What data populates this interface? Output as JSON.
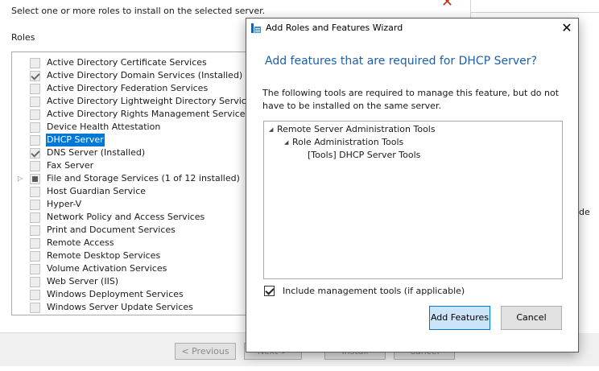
{
  "background": {
    "instruction": "Select one or more roles to install on the selected server.",
    "roles_heading": "Roles",
    "side_fragment": "de",
    "roles": [
      {
        "label": "Active Directory Certificate Services",
        "state": "unchecked",
        "expandable": false,
        "selected": false
      },
      {
        "label": "Active Directory Domain Services (Installed)",
        "state": "checked",
        "expandable": false,
        "selected": false
      },
      {
        "label": "Active Directory Federation Services",
        "state": "unchecked",
        "expandable": false,
        "selected": false
      },
      {
        "label": "Active Directory Lightweight Directory Services",
        "state": "unchecked",
        "expandable": false,
        "selected": false
      },
      {
        "label": "Active Directory Rights Management Services",
        "state": "unchecked",
        "expandable": false,
        "selected": false
      },
      {
        "label": "Device Health Attestation",
        "state": "unchecked",
        "expandable": false,
        "selected": false
      },
      {
        "label": "DHCP Server",
        "state": "unchecked",
        "expandable": false,
        "selected": true
      },
      {
        "label": "DNS Server (Installed)",
        "state": "checked",
        "expandable": false,
        "selected": false
      },
      {
        "label": "Fax Server",
        "state": "unchecked",
        "expandable": false,
        "selected": false
      },
      {
        "label": "File and Storage Services (1 of 12 installed)",
        "state": "partial",
        "expandable": true,
        "selected": false
      },
      {
        "label": "Host Guardian Service",
        "state": "unchecked",
        "expandable": false,
        "selected": false
      },
      {
        "label": "Hyper-V",
        "state": "unchecked",
        "expandable": false,
        "selected": false
      },
      {
        "label": "Network Policy and Access Services",
        "state": "unchecked",
        "expandable": false,
        "selected": false
      },
      {
        "label": "Print and Document Services",
        "state": "unchecked",
        "expandable": false,
        "selected": false
      },
      {
        "label": "Remote Access",
        "state": "unchecked",
        "expandable": false,
        "selected": false
      },
      {
        "label": "Remote Desktop Services",
        "state": "unchecked",
        "expandable": false,
        "selected": false
      },
      {
        "label": "Volume Activation Services",
        "state": "unchecked",
        "expandable": false,
        "selected": false
      },
      {
        "label": "Web Server (IIS)",
        "state": "unchecked",
        "expandable": false,
        "selected": false
      },
      {
        "label": "Windows Deployment Services",
        "state": "unchecked",
        "expandable": false,
        "selected": false
      },
      {
        "label": "Windows Server Update Services",
        "state": "unchecked",
        "expandable": false,
        "selected": false
      }
    ],
    "buttons": {
      "previous": "< Previous",
      "next": "Next >",
      "install": "Install",
      "cancel": "Cancel"
    }
  },
  "dialog": {
    "title": "Add Roles and Features Wizard",
    "heading": "Add features that are required for DHCP Server?",
    "description": "The following tools are required to manage this feature, but do not have to be installed on the same server.",
    "tree": [
      {
        "label": "Remote Server Administration Tools",
        "level": 0,
        "expanded": true
      },
      {
        "label": "Role Administration Tools",
        "level": 1,
        "expanded": true
      },
      {
        "label": "[Tools] DHCP Server Tools",
        "level": 2,
        "expanded": false
      }
    ],
    "include_tools_label": "Include management tools (if applicable)",
    "include_tools_checked": true,
    "add_button": "Add Features",
    "cancel_button": "Cancel"
  },
  "colors": {
    "accent": "#0078d7",
    "heading_blue": "#1e5faa",
    "close_red": "#c42b1c"
  }
}
